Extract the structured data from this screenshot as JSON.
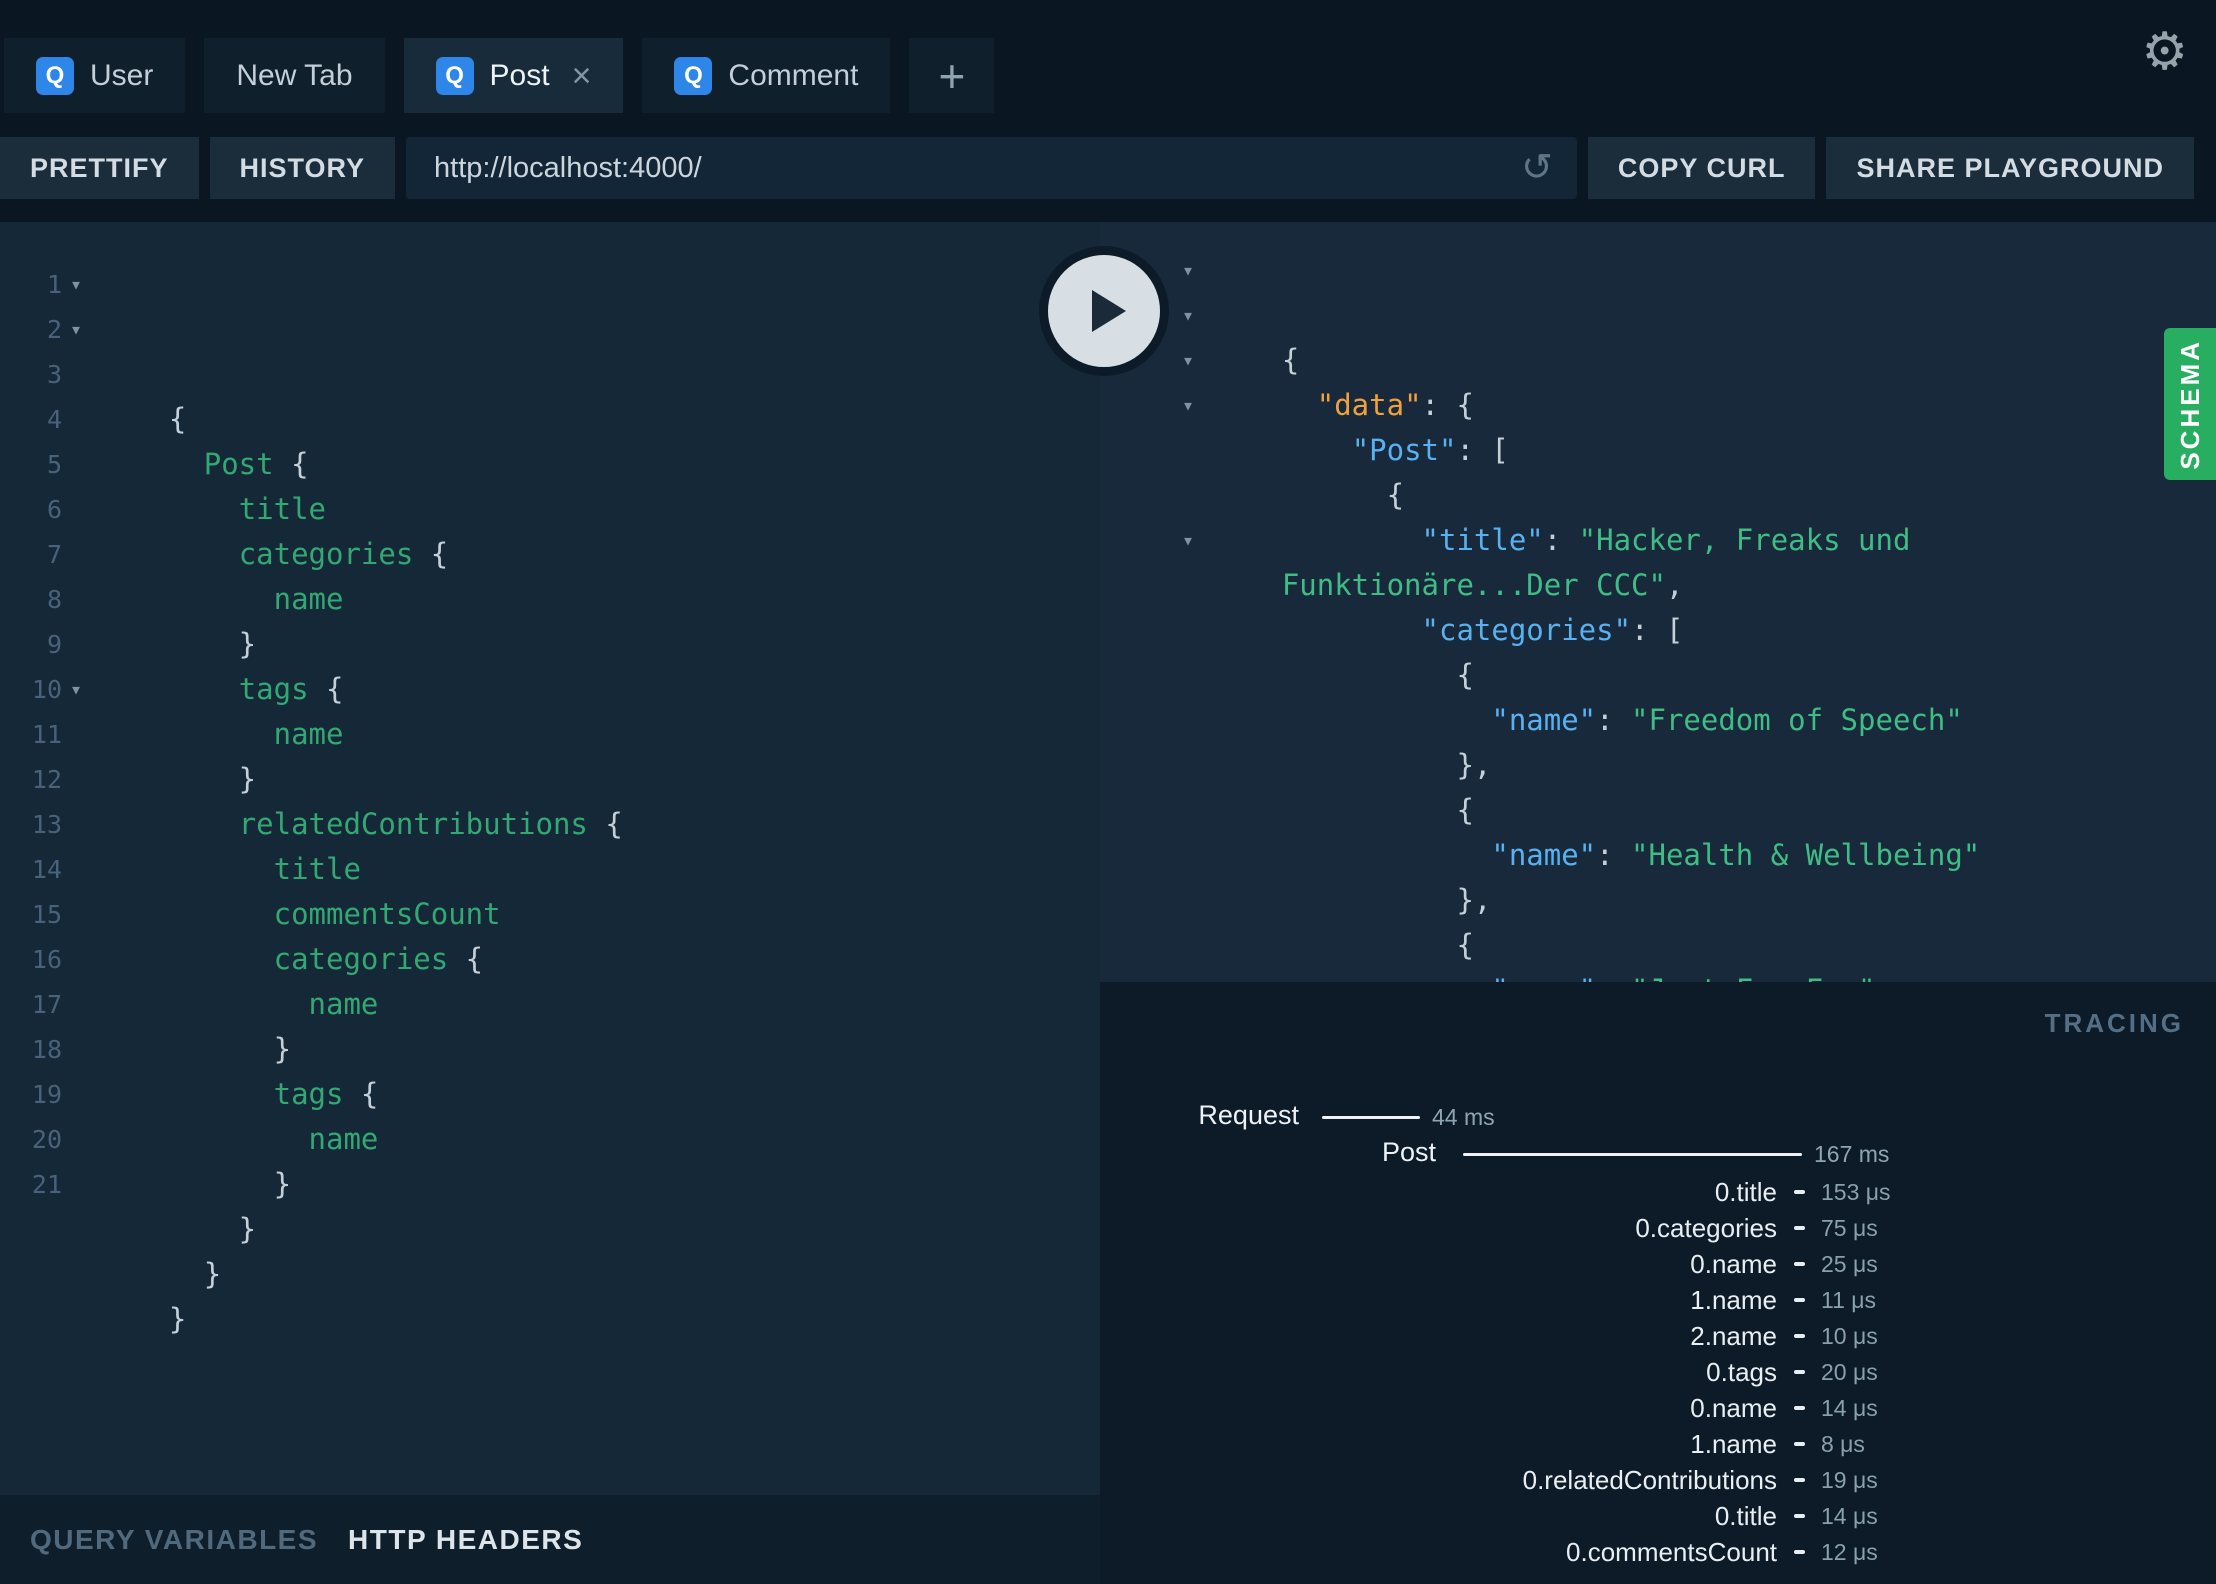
{
  "tabs": [
    {
      "label": "User",
      "badge": "Q",
      "close": "",
      "active": false
    },
    {
      "label": "New Tab",
      "badge": "",
      "close": "",
      "active": false
    },
    {
      "label": "Post",
      "badge": "Q",
      "close": "×",
      "active": true
    },
    {
      "label": "Comment",
      "badge": "Q",
      "close": "",
      "active": false
    }
  ],
  "tabbar": {
    "new_tab_label": "+"
  },
  "glyphs": {
    "caret": "▾",
    "gear": "⚙",
    "refresh": "↺"
  },
  "toolbar": {
    "prettify": "PRETTIFY",
    "history": "HISTORY",
    "url": "http://localhost:4000/",
    "copy_curl": "COPY CURL",
    "share": "SHARE PLAYGROUND"
  },
  "editor": {
    "lines": [
      {
        "n": "1",
        "c": 1,
        "s": [
          [
            "{",
            "pun"
          ]
        ]
      },
      {
        "n": "2",
        "c": 1,
        "s": [
          [
            "  ",
            ""
          ],
          [
            "Post",
            "fld"
          ],
          [
            " {",
            "pun"
          ]
        ]
      },
      {
        "n": "3",
        "s": [
          [
            "    ",
            ""
          ],
          [
            "title",
            "fld"
          ]
        ]
      },
      {
        "n": "4",
        "s": [
          [
            "    ",
            ""
          ],
          [
            "categories",
            "fld"
          ],
          [
            " {",
            "pun"
          ]
        ]
      },
      {
        "n": "5",
        "s": [
          [
            "      ",
            ""
          ],
          [
            "name",
            "fld"
          ]
        ]
      },
      {
        "n": "6",
        "s": [
          [
            "    }",
            "pun"
          ]
        ]
      },
      {
        "n": "7",
        "s": [
          [
            "    ",
            ""
          ],
          [
            "tags",
            "fld"
          ],
          [
            " {",
            "pun"
          ]
        ]
      },
      {
        "n": "8",
        "s": [
          [
            "      ",
            ""
          ],
          [
            "name",
            "fld"
          ]
        ]
      },
      {
        "n": "9",
        "s": [
          [
            "    }",
            "pun"
          ]
        ]
      },
      {
        "n": "10",
        "c": 1,
        "s": [
          [
            "    ",
            ""
          ],
          [
            "relatedContributions",
            "fld"
          ],
          [
            " {",
            "pun"
          ]
        ]
      },
      {
        "n": "11",
        "s": [
          [
            "      ",
            ""
          ],
          [
            "title",
            "fld"
          ]
        ]
      },
      {
        "n": "12",
        "s": [
          [
            "      ",
            ""
          ],
          [
            "commentsCount",
            "fld"
          ]
        ]
      },
      {
        "n": "13",
        "s": [
          [
            "      ",
            ""
          ],
          [
            "categories",
            "fld"
          ],
          [
            " {",
            "pun"
          ]
        ]
      },
      {
        "n": "14",
        "s": [
          [
            "        ",
            ""
          ],
          [
            "name",
            "fld"
          ]
        ]
      },
      {
        "n": "15",
        "s": [
          [
            "      }",
            "pun"
          ]
        ]
      },
      {
        "n": "16",
        "s": [
          [
            "      ",
            ""
          ],
          [
            "tags",
            "fld"
          ],
          [
            " {",
            "pun"
          ]
        ]
      },
      {
        "n": "17",
        "s": [
          [
            "        ",
            ""
          ],
          [
            "name",
            "fld"
          ]
        ]
      },
      {
        "n": "18",
        "s": [
          [
            "      }",
            "pun"
          ]
        ]
      },
      {
        "n": "19",
        "s": [
          [
            "    }",
            "pun"
          ]
        ]
      },
      {
        "n": "20",
        "s": [
          [
            "  }",
            "pun"
          ]
        ]
      },
      {
        "n": "21",
        "s": [
          [
            "}",
            "pun"
          ]
        ]
      }
    ]
  },
  "response": {
    "lines": [
      {
        "c": 1,
        "s": [
          [
            "{",
            "pun"
          ]
        ]
      },
      {
        "c": 1,
        "s": [
          [
            "  ",
            ""
          ],
          [
            "\"data\"",
            "ko"
          ],
          [
            ": {",
            "pun"
          ]
        ]
      },
      {
        "c": 1,
        "s": [
          [
            "    ",
            ""
          ],
          [
            "\"Post\"",
            "kb"
          ],
          [
            ": [",
            "pun"
          ]
        ]
      },
      {
        "c": 1,
        "s": [
          [
            "      {",
            "pun"
          ]
        ]
      },
      {
        "s": [
          [
            "        ",
            ""
          ],
          [
            "\"title\"",
            "kb"
          ],
          [
            ": ",
            "pun"
          ],
          [
            "\"Hacker, Freaks und",
            "str"
          ]
        ]
      },
      {
        "s": [
          [
            "Funktionäre...Der CCC\"",
            "str"
          ],
          [
            ",",
            "pun"
          ]
        ]
      },
      {
        "c": 1,
        "s": [
          [
            "        ",
            ""
          ],
          [
            "\"categories\"",
            "kb"
          ],
          [
            ": [",
            "pun"
          ]
        ]
      },
      {
        "s": [
          [
            "          {",
            "pun"
          ]
        ]
      },
      {
        "s": [
          [
            "            ",
            ""
          ],
          [
            "\"name\"",
            "kb"
          ],
          [
            ": ",
            "pun"
          ],
          [
            "\"Freedom of Speech\"",
            "str"
          ]
        ]
      },
      {
        "s": [
          [
            "          },",
            "pun"
          ]
        ]
      },
      {
        "s": [
          [
            "          {",
            "pun"
          ]
        ]
      },
      {
        "s": [
          [
            "            ",
            ""
          ],
          [
            "\"name\"",
            "kb"
          ],
          [
            ": ",
            "pun"
          ],
          [
            "\"Health & Wellbeing\"",
            "str"
          ]
        ]
      },
      {
        "s": [
          [
            "          },",
            "pun"
          ]
        ]
      },
      {
        "s": [
          [
            "          {",
            "pun"
          ]
        ]
      },
      {
        "s": [
          [
            "            ",
            ""
          ],
          [
            "\"name\"",
            "kb"
          ],
          [
            ": ",
            "pun"
          ],
          [
            "\"Just For Fun\"",
            "str"
          ]
        ]
      },
      {
        "s": [
          [
            "          }",
            "pun"
          ]
        ]
      },
      {
        "s": [
          [
            "        ]",
            "pun"
          ]
        ]
      }
    ]
  },
  "schema": {
    "label": "SCHEMA",
    "color": "#27ae60"
  },
  "tracing": {
    "title": "TRACING",
    "request_label": "Request",
    "request_value": "44 ms",
    "resolver_label": "Post",
    "resolver_value": "167 ms",
    "rows": [
      {
        "label": "0.title",
        "value": "153 μs"
      },
      {
        "label": "0.categories",
        "value": "75 μs"
      },
      {
        "label": "0.name",
        "value": "25 μs"
      },
      {
        "label": "1.name",
        "value": "11 μs"
      },
      {
        "label": "2.name",
        "value": "10 μs"
      },
      {
        "label": "0.tags",
        "value": "20 μs"
      },
      {
        "label": "0.name",
        "value": "14 μs"
      },
      {
        "label": "1.name",
        "value": "8 μs"
      },
      {
        "label": "0.relatedContributions",
        "value": "19 μs"
      },
      {
        "label": "0.title",
        "value": "14 μs"
      },
      {
        "label": "0.commentsCount",
        "value": "12 μs"
      }
    ]
  },
  "footer": {
    "query_variables": "QUERY VARIABLES",
    "http_headers": "HTTP HEADERS"
  },
  "colors": {
    "badge_blue": "#2e86e8",
    "schema_green": "#27ae60",
    "field_green": "#33a873",
    "key_blue": "#5ab1f0",
    "key_orange": "#f0a13e",
    "string_green": "#3fbd85"
  }
}
